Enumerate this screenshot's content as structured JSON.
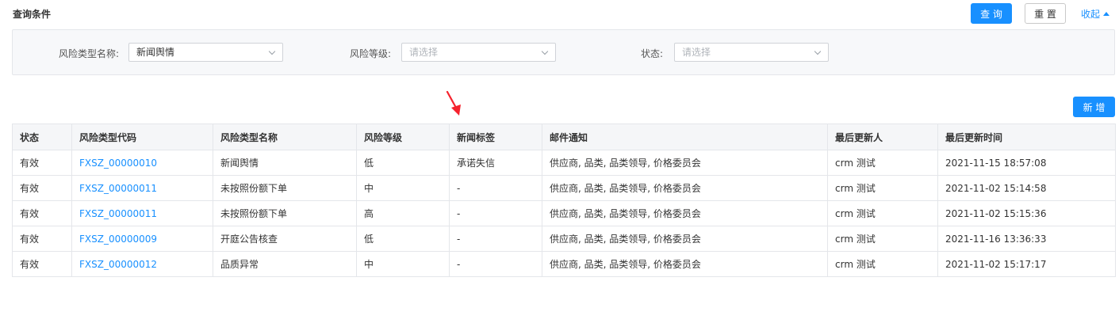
{
  "header": {
    "title": "查询条件",
    "query_label": "查 询",
    "reset_label": "重 置",
    "collapse_label": "收起"
  },
  "filters": {
    "risk_type_name": {
      "label": "风险类型名称:",
      "value": "新闻舆情"
    },
    "risk_level": {
      "label": "风险等级:",
      "placeholder": "请选择"
    },
    "status": {
      "label": "状态:",
      "placeholder": "请选择"
    }
  },
  "toolbar": {
    "add_label": "新 增"
  },
  "table": {
    "columns": [
      "状态",
      "风险类型代码",
      "风险类型名称",
      "风险等级",
      "新闻标签",
      "邮件通知",
      "最后更新人",
      "最后更新时间"
    ],
    "rows": [
      [
        "有效",
        "FXSZ_00000010",
        "新闻舆情",
        "低",
        "承诺失信",
        "供应商, 品类, 品类领导, 价格委员会",
        "crm 测试",
        "2021-11-15 18:57:08"
      ],
      [
        "有效",
        "FXSZ_00000011",
        "未按照份额下单",
        "中",
        "-",
        "供应商, 品类, 品类领导, 价格委员会",
        "crm 测试",
        "2021-11-02 15:14:58"
      ],
      [
        "有效",
        "FXSZ_00000011",
        "未按照份额下单",
        "高",
        "-",
        "供应商, 品类, 品类领导, 价格委员会",
        "crm 测试",
        "2021-11-02 15:15:36"
      ],
      [
        "有效",
        "FXSZ_00000009",
        "开庭公告核查",
        "低",
        "-",
        "供应商, 品类, 品类领导, 价格委员会",
        "crm 测试",
        "2021-11-16 13:36:33"
      ],
      [
        "有效",
        "FXSZ_00000012",
        "品质异常",
        "中",
        "-",
        "供应商, 品类, 品类领导, 价格委员会",
        "crm 测试",
        "2021-11-02 15:17:17"
      ]
    ]
  },
  "colors": {
    "primary": "#1890ff",
    "annotation_arrow": "#f5222d"
  }
}
